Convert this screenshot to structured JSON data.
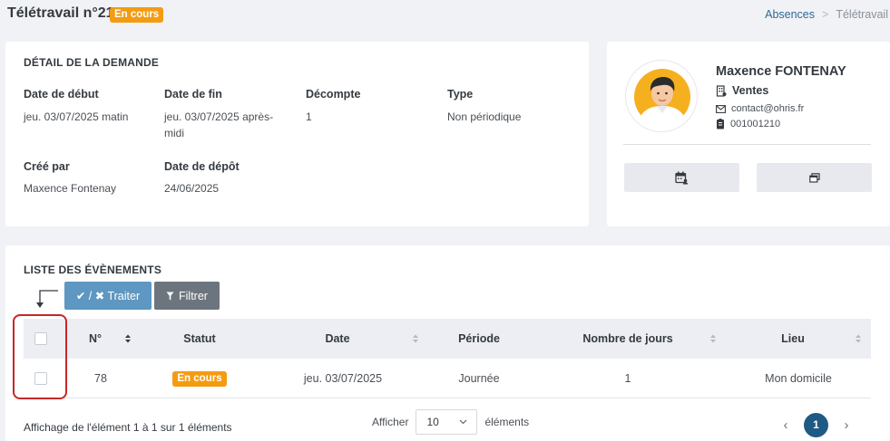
{
  "header": {
    "title": "Télétravail n°21",
    "status_badge": "En cours",
    "breadcrumb": {
      "link": "Absences",
      "separator": ">",
      "current": "Télétravail"
    }
  },
  "colors": {
    "badge": "#f39c12",
    "primary_button": "#5e97c1",
    "secondary_button": "#6c757d",
    "active_page": "#1f5a85",
    "highlight": "#c62828"
  },
  "detail": {
    "section_title": "DÉTAIL DE LA DEMANDE",
    "start_label": "Date de début",
    "start_value": "jeu. 03/07/2025 matin",
    "end_label": "Date de fin",
    "end_value_line1": "jeu. 03/07/2025 après-",
    "end_value_line2": "midi",
    "count_label": "Décompte",
    "count_value": "1",
    "type_label": "Type",
    "type_value": "Non périodique",
    "created_by_label": "Créé par",
    "created_by_value": "Maxence Fontenay",
    "deposit_label": "Date de dépôt",
    "deposit_value": "24/06/2025"
  },
  "profile": {
    "name": "Maxence FONTENAY",
    "department": "Ventes",
    "email": "contact@ohris.fr",
    "employee_id": "001001210",
    "icons": [
      "building-icon",
      "mail-icon",
      "badge-icon",
      "calendar-user-icon",
      "window-icon"
    ]
  },
  "events": {
    "section_title": "LISTE DES ÉVÈNEMENTS",
    "process_button": "✔ / ✖ Traiter",
    "filter_button": "Filtrer",
    "columns": [
      "N°",
      "Statut",
      "Date",
      "Période",
      "Nombre de jours",
      "Lieu"
    ],
    "rows": [
      {
        "number": "78",
        "status": "En cours",
        "date": "jeu. 03/07/2025",
        "period": "Journée",
        "days": "1",
        "place": "Mon domicile"
      }
    ],
    "footer_info": "Affichage de l'élément 1 à 1 sur 1 éléments",
    "show_label": "Afficher",
    "page_size": "10",
    "elements_label": "éléments",
    "prev": "‹",
    "current_page": "1",
    "next": "›"
  }
}
